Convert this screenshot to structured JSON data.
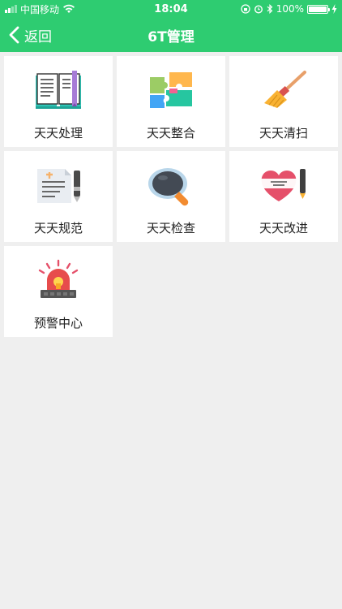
{
  "status": {
    "carrier": "中国移动",
    "time": "18:04",
    "battery": "100%",
    "battery_level": 1.0
  },
  "nav": {
    "back_label": "返回",
    "title": "6T管理"
  },
  "tiles": [
    {
      "label": "天天处理",
      "icon": "book-icon"
    },
    {
      "label": "天天整合",
      "icon": "puzzle-icon"
    },
    {
      "label": "天天清扫",
      "icon": "broom-icon"
    },
    {
      "label": "天天规范",
      "icon": "document-pen-icon"
    },
    {
      "label": "天天检查",
      "icon": "magnifier-icon"
    },
    {
      "label": "天天改进",
      "icon": "heart-pen-icon"
    },
    {
      "label": "预警中心",
      "icon": "alarm-light-icon"
    }
  ],
  "colors": {
    "accent": "#2ecc71",
    "background": "#efefef"
  }
}
